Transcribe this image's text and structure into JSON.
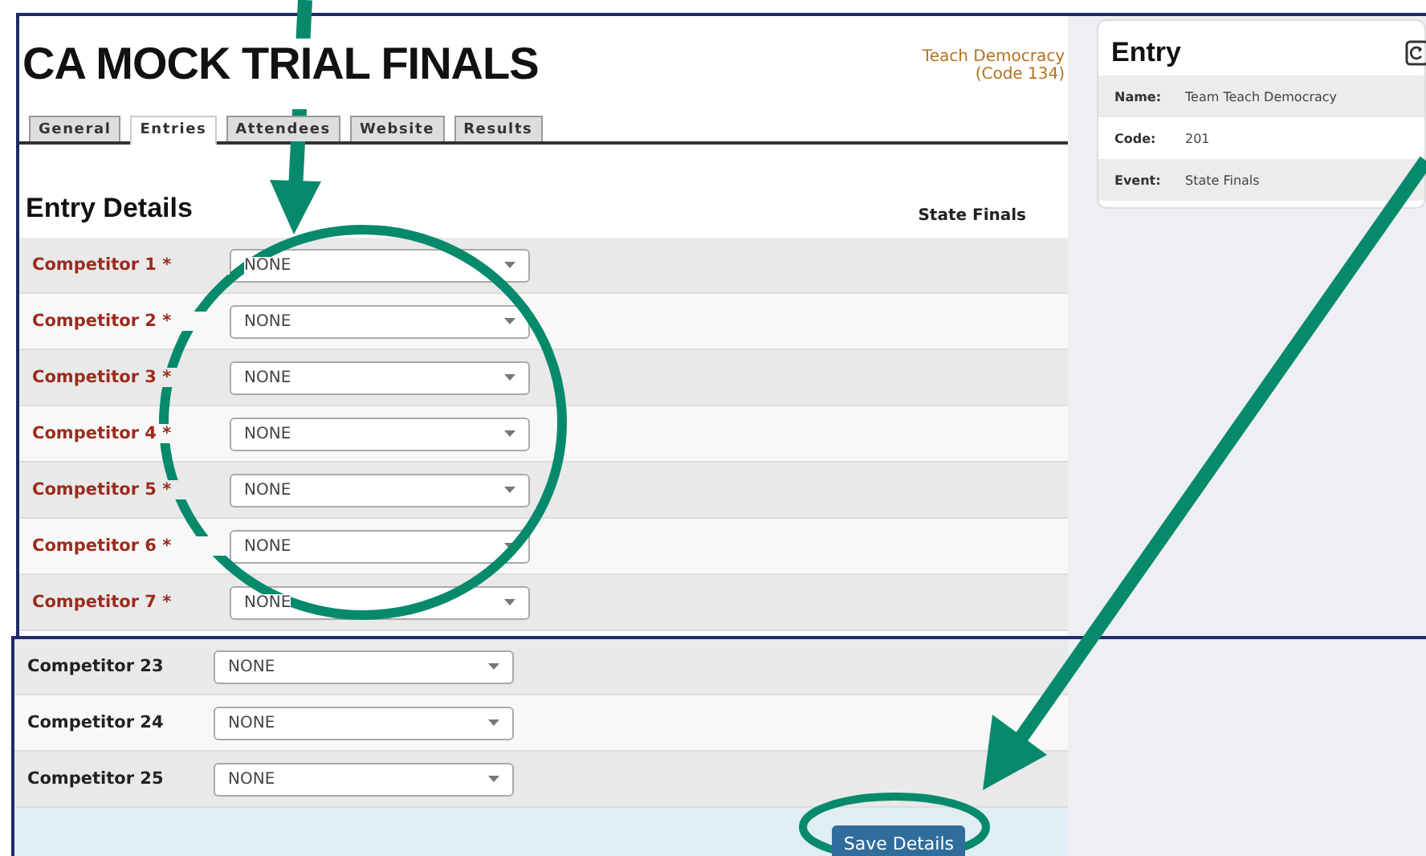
{
  "header": {
    "title": "CA MOCK TRIAL FINALS",
    "organization": "Teach Democracy",
    "code": "(Code 134)"
  },
  "tabs": [
    {
      "label": "General",
      "selected": false
    },
    {
      "label": "Entries",
      "selected": true
    },
    {
      "label": "Attendees",
      "selected": false
    },
    {
      "label": "Website",
      "selected": false
    },
    {
      "label": "Results",
      "selected": false
    }
  ],
  "section": {
    "title": "Entry Details",
    "event": "State Finals"
  },
  "competitors": [
    {
      "label": "Competitor 1 *",
      "required": true,
      "value": "NONE"
    },
    {
      "label": "Competitor 2 *",
      "required": true,
      "value": "NONE"
    },
    {
      "label": "Competitor 3 *",
      "required": true,
      "value": "NONE"
    },
    {
      "label": "Competitor 4 *",
      "required": true,
      "value": "NONE"
    },
    {
      "label": "Competitor 5 *",
      "required": true,
      "value": "NONE"
    },
    {
      "label": "Competitor 6 *",
      "required": true,
      "value": "NONE"
    },
    {
      "label": "Competitor 7 *",
      "required": true,
      "value": "NONE"
    }
  ],
  "more_competitors": [
    {
      "label": "Competitor 23",
      "required": false,
      "value": "NONE"
    },
    {
      "label": "Competitor 24",
      "required": false,
      "value": "NONE"
    },
    {
      "label": "Competitor 25",
      "required": false,
      "value": "NONE"
    }
  ],
  "save_button": "Save Details",
  "entry_card": {
    "title": "Entry",
    "fields": [
      {
        "label": "Name:",
        "value": "Team Teach Democracy"
      },
      {
        "label": "Code:",
        "value": "201"
      },
      {
        "label": "Event:",
        "value": "State Finals"
      }
    ]
  }
}
